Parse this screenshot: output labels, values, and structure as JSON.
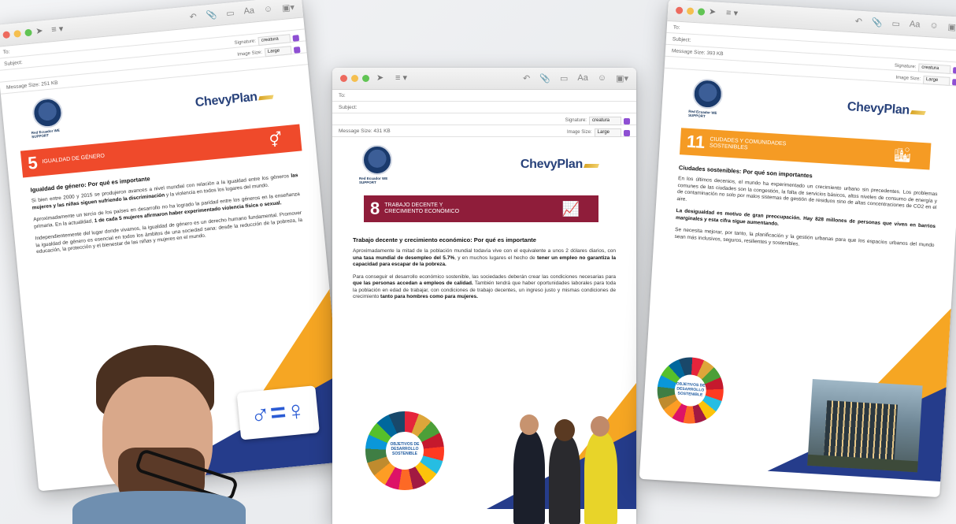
{
  "toolbar_labels": {
    "list": "≡ ▾",
    "aa": "Aa"
  },
  "mail_fields": {
    "to": "To:",
    "subject": "Subject:",
    "signature_label": "Signature:",
    "signature_value": "creatura",
    "image_size_label": "Image Size:",
    "image_size_value": "Large"
  },
  "logos": {
    "chevy": "ChevyPlan",
    "globe_caption": "Red Ecuador WE SUPPORT"
  },
  "windows": [
    {
      "message_size": "Message Size: 251 KB",
      "goal_number": "5",
      "goal_title": "Igualdad de género",
      "goal_icon": "gender-equality-icon",
      "heading": "Igualdad de género: Por qué es importante",
      "paragraphs": [
        [
          "Si bien entre 2000 y 2015 se produjeron avances a nivel mundial con relación a la igualdad entre los géneros ",
          "las mujeres y las niñas siguen sufriendo la discriminación",
          " y la violencia en todos los lugares del mundo."
        ],
        [
          "Aproximadamente un tercio de los países en desarrollo no ha logrado la paridad entre los géneros en la enseñanza primaria. En la actualidad, ",
          "1 de cada 5 mujeres afirmaron haber experimentado violencia física o sexual.",
          ""
        ],
        [
          "Independientemente del lugar donde vivamos, la igualdad de género es un derecho humano fundamental. Promover la igualdad de género es esencial en todos los ámbitos de una sociedad sana: desde la reducción de la pobreza, la educación, la protección y el bienestar de las niñas y mujeres en el mundo.",
          "",
          ""
        ]
      ],
      "card_text": "♂=♀"
    },
    {
      "message_size": "Message Size: 431 KB",
      "goal_number": "8",
      "goal_title": "Trabajo decente y crecimiento económico",
      "goal_icon": "growth-chart-icon",
      "heading": "Trabajo decente y crecimiento económico: Por qué es importante",
      "paragraphs": [
        [
          "Aproximadamente la mitad de la población mundial todavía vive con el equivalente a unos 2 dólares diarios, con ",
          "una tasa mundial de desempleo del 5.7%",
          ", y en muchos lugares el hecho de ",
          "tener un empleo no garantiza la capacidad para escapar de la pobreza."
        ],
        [
          "Para conseguir el desarrollo económico sostenible, las sociedades deberán crear las condiciones necesarias para ",
          "que las personas accedan a empleos de calidad.",
          " También tendrá que haber oportunidades laborales para toda la población en edad de trabajar, con condiciones de trabajo decentes, un ingreso justo y mismas condiciones de crecimiento ",
          "tanto para hombres como para mujeres."
        ]
      ],
      "wheel_text": "OBJETIVOS DE DESARROLLO SOSTENIBLE"
    },
    {
      "message_size": "Message Size: 393 KB",
      "goal_number": "11",
      "goal_title": "Ciudades y comunidades sostenibles",
      "goal_icon": "city-buildings-icon",
      "heading": "Ciudades sostenibles: Por qué son importantes",
      "paragraphs": [
        [
          "En los últimos decenios, el mundo ha experimentado un crecimiento urbano sin precedentes. Los problemas comunes de las ciudades son la congestión, la falta de servicios básicos, altos niveles de consumo de energía y de contaminación no solo por malos sistemas de gestión de residuos sino de altas concentraciones de CO2 en el aire.",
          "",
          ""
        ],
        [
          "",
          "La desigualdad es motivo de gran preocupación. Hay 828 millones de personas que viven en barrios marginales y esta cifra sigue aumentando.",
          ""
        ],
        [
          "Se necesita mejorar, por tanto, la planificación y la gestión urbanas para que los espacios urbanos del mundo sean más inclusivos, seguros, resilientes y sostenibles.",
          "",
          ""
        ]
      ],
      "wheel_text": "OBJETIVOS DE DESARROLLO SOSTENIBLE"
    }
  ],
  "colors": {
    "goal5": "#ef4a2b",
    "goal8": "#8f1d3a",
    "goal11": "#f59b24",
    "navy": "#253c8b",
    "orange": "#f6a623"
  }
}
